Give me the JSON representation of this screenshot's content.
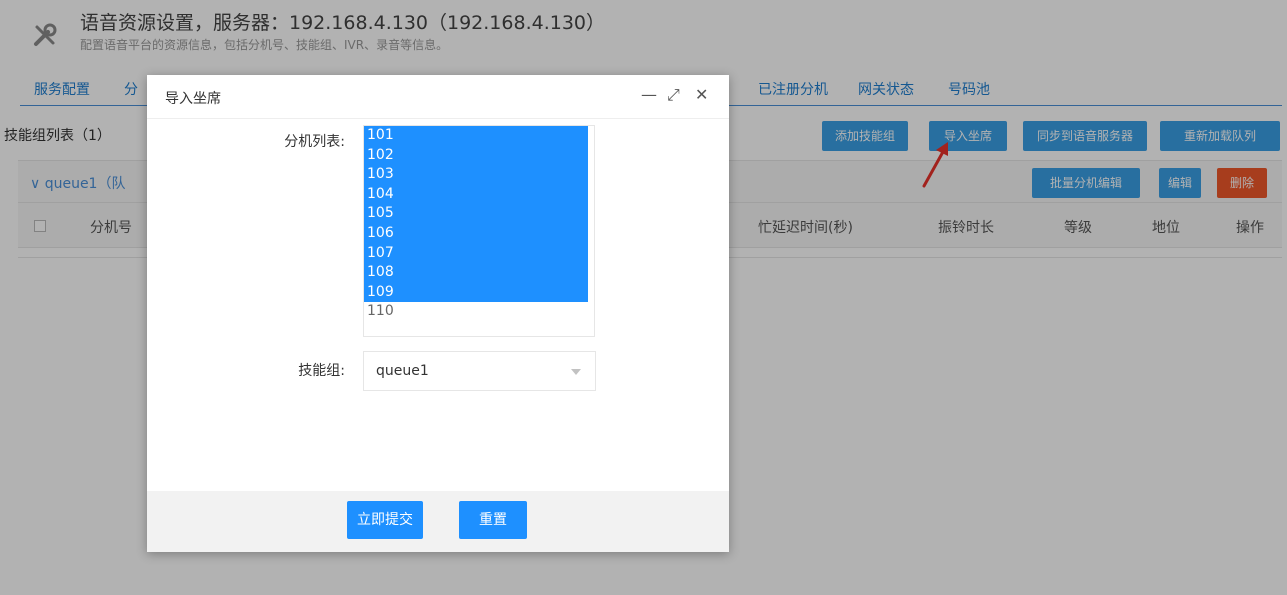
{
  "header": {
    "icon": "tools-icon",
    "title": "语音资源设置，服务器：192.168.4.130（192.168.4.130）",
    "subtitle": "配置语音平台的资源信息，包括分机号、技能组、IVR、录音等信息。"
  },
  "tabs": [
    {
      "label": "服务配置"
    },
    {
      "label": "分"
    },
    {
      "label": "已注册分机"
    },
    {
      "label": "网关状态"
    },
    {
      "label": "号码池"
    }
  ],
  "skill_list": {
    "title": "技能组列表（1）",
    "buttons": {
      "add_group": "添加技能组",
      "import_seats": "导入坐席",
      "sync": "同步到语音服务器",
      "reload": "重新加载队列"
    }
  },
  "group": {
    "label": "∨ queue1（队",
    "buttons": {
      "batch_edit": "批量分机编辑",
      "edit": "编辑",
      "delete": "删除"
    }
  },
  "table": {
    "headers": [
      "分机号",
      "忙延迟时间(秒)",
      "振铃时长",
      "等级",
      "地位",
      "操作"
    ]
  },
  "dialog": {
    "title": "导入坐席",
    "minimize_icon": "—",
    "maximize_icon": "⤢",
    "close_icon": "✕",
    "extension_label": "分机列表:",
    "extensions": [
      {
        "value": "101",
        "selected": true
      },
      {
        "value": "102",
        "selected": true
      },
      {
        "value": "103",
        "selected": true
      },
      {
        "value": "104",
        "selected": true
      },
      {
        "value": "105",
        "selected": true
      },
      {
        "value": "106",
        "selected": true
      },
      {
        "value": "107",
        "selected": true
      },
      {
        "value": "108",
        "selected": true
      },
      {
        "value": "109",
        "selected": true
      },
      {
        "value": "110",
        "selected": false
      }
    ],
    "group_label": "技能组:",
    "group_value": "queue1",
    "submit": "立即提交",
    "reset": "重置"
  },
  "colors": {
    "accent": "#1e90ff",
    "tab_text": "#1f7ed0",
    "danger": "#f0582a",
    "arrow": "#e8312a"
  }
}
